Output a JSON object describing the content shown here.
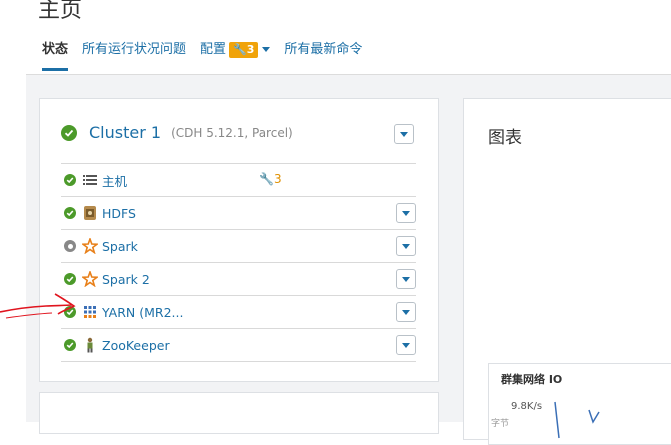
{
  "page": {
    "title": "主页"
  },
  "tabs": [
    {
      "label": "状态"
    },
    {
      "label": "所有运行状况问题"
    },
    {
      "label": "配置",
      "badge": "3"
    },
    {
      "label": "所有最新命令"
    }
  ],
  "cluster": {
    "name": "Cluster 1",
    "version": "(CDH 5.12.1, Parcel)"
  },
  "services": [
    {
      "name": "主机",
      "status": "ok",
      "icon": "list-icon",
      "warning": "3"
    },
    {
      "name": "HDFS",
      "status": "ok",
      "icon": "hdfs-icon"
    },
    {
      "name": "Spark",
      "status": "stopped",
      "icon": "spark-icon"
    },
    {
      "name": "Spark 2",
      "status": "ok",
      "icon": "spark-icon"
    },
    {
      "name": "YARN (MR2...",
      "status": "ok",
      "icon": "yarn-icon"
    },
    {
      "name": "ZooKeeper",
      "status": "ok",
      "icon": "zookeeper-icon"
    }
  ],
  "charts": {
    "title": "图表",
    "card": {
      "title": "群集网络 IO",
      "ytick": "9.8K/s",
      "ylabel": "字节"
    }
  },
  "colors": {
    "link": "#1c6fa6",
    "ok": "#4c9a2a",
    "warn": "#f0a30a",
    "annotation": "#e0141e"
  }
}
